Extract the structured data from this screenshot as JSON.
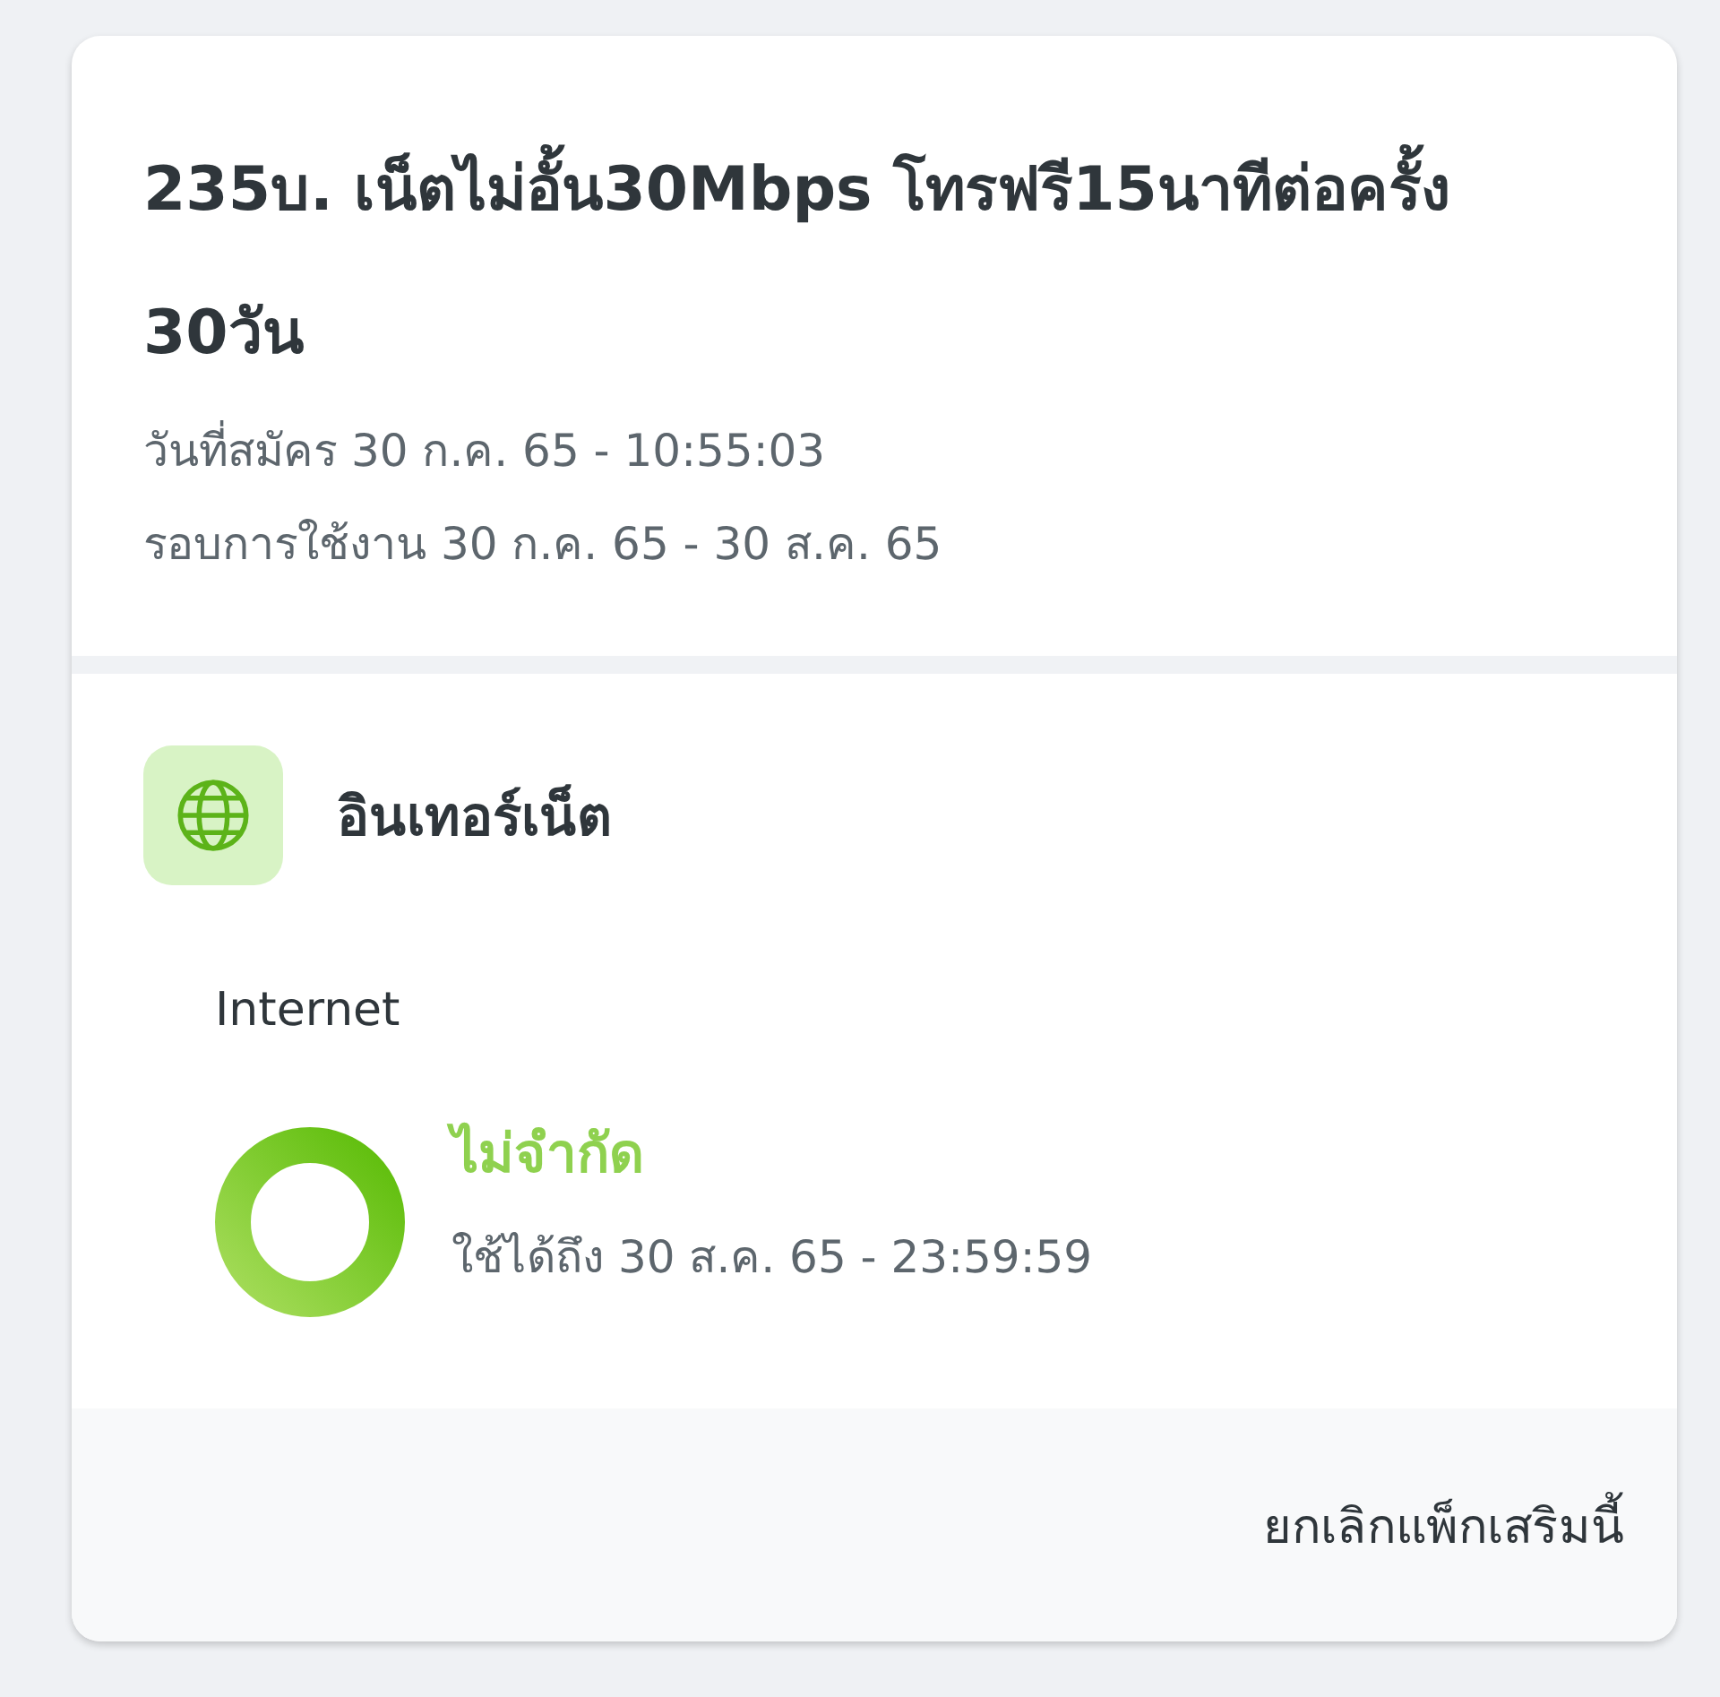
{
  "package": {
    "title": "235บ. เน็ตไม่อั้น30Mbps โทรฟรี15นาทีต่อครั้ง 30วัน",
    "details": [
      "วันที่สมัคร 30 ก.ค. 65 - 10:55:03",
      "รอบการใช้งาน 30 ก.ค. 65 - 30 ส.ค. 65"
    ]
  },
  "benefits": [
    {
      "kind": "internet",
      "heading": "อินเทอร์เน็ต",
      "items": [
        {
          "label": "Internet",
          "amount": "ไม่จำกัด",
          "valid_until": "ใช้ได้ถึง 30 ส.ค. 65 - 23:59:59"
        }
      ]
    }
  ],
  "footer": {
    "action": "ยกเลิกแพ็กเสริมนี้"
  }
}
